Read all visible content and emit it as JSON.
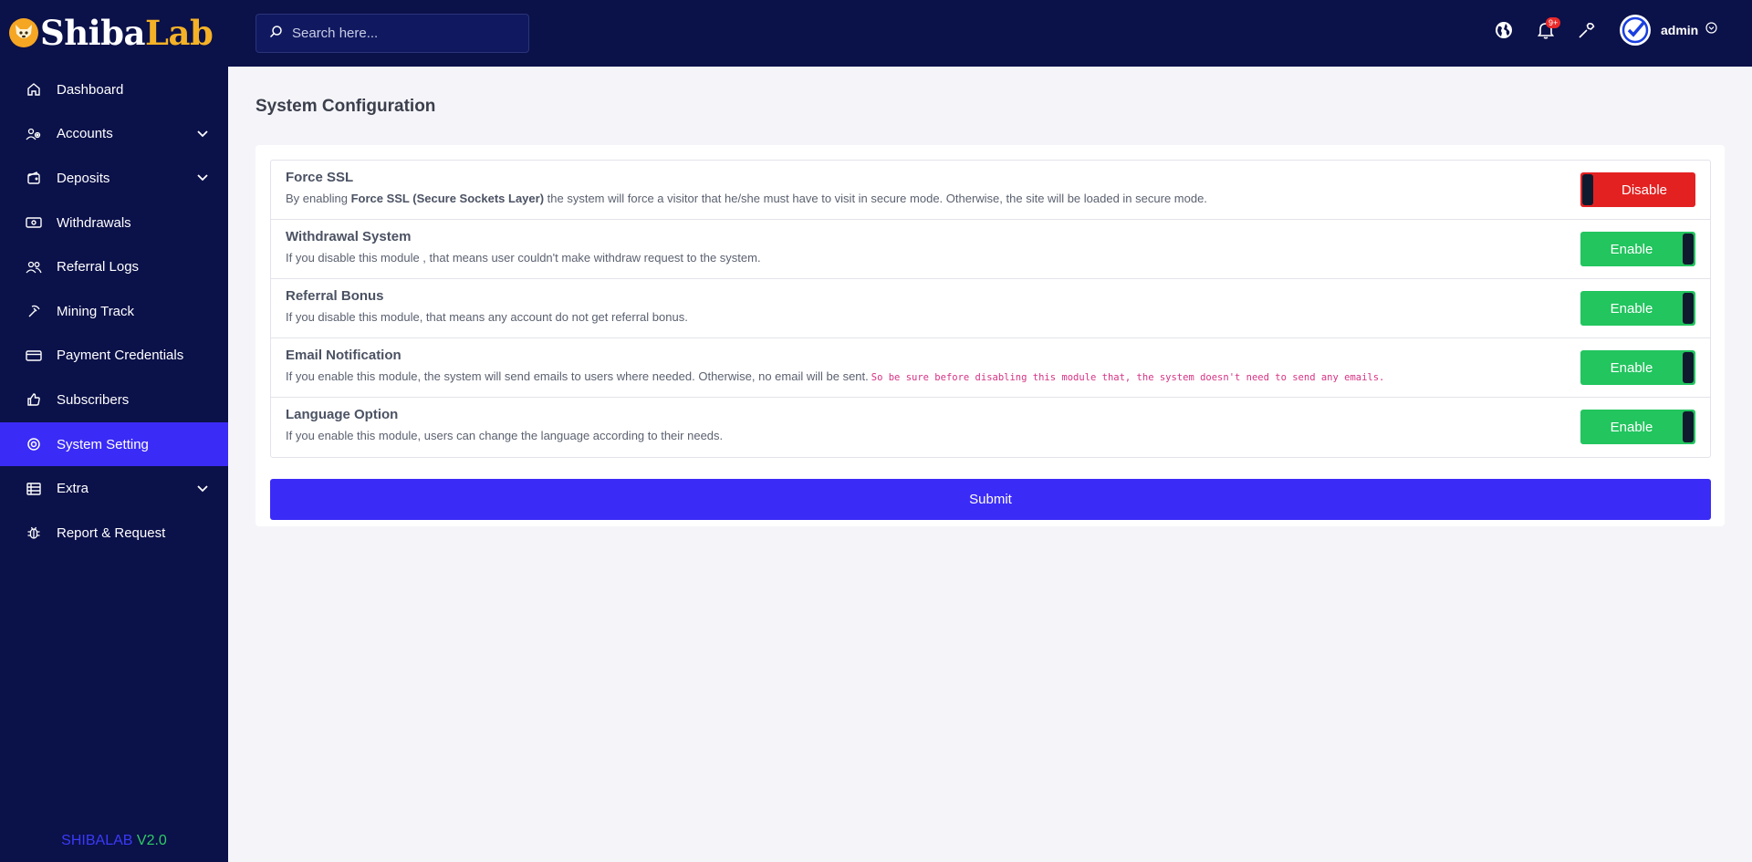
{
  "brand": {
    "part1": "Shiba",
    "part2": "Lab",
    "icon": "shiba-dog-icon"
  },
  "sidebar": {
    "items": [
      {
        "label": "Dashboard",
        "icon": "home-icon",
        "has_children": false
      },
      {
        "label": "Accounts",
        "icon": "users-gear-icon",
        "has_children": true
      },
      {
        "label": "Deposits",
        "icon": "wallet-icon",
        "has_children": true
      },
      {
        "label": "Withdrawals",
        "icon": "cash-icon",
        "has_children": false
      },
      {
        "label": "Referral Logs",
        "icon": "users-icon",
        "has_children": false
      },
      {
        "label": "Mining Track",
        "icon": "pickaxe-icon",
        "has_children": false
      },
      {
        "label": "Payment Credentials",
        "icon": "credit-card-icon",
        "has_children": false
      },
      {
        "label": "Subscribers",
        "icon": "thumbs-up-icon",
        "has_children": false
      },
      {
        "label": "System Setting",
        "icon": "settings-icon",
        "has_children": false,
        "active": true
      },
      {
        "label": "Extra",
        "icon": "list-icon",
        "has_children": true
      },
      {
        "label": "Report & Request",
        "icon": "bug-icon",
        "has_children": false
      }
    ],
    "version_name": "SHIBALAB",
    "version_num": "V2.0"
  },
  "header": {
    "search_placeholder": "Search here...",
    "notification_badge": "9+",
    "user_name": "admin"
  },
  "main": {
    "title": "System Configuration",
    "settings": [
      {
        "title": "Force SSL",
        "desc_pre": "By enabling ",
        "desc_bold": "Force SSL (Secure Sockets Layer)",
        "desc_post": " the system will force a visitor that he/she must have to visit in secure mode. Otherwise, the site will be loaded in secure mode.",
        "state_label": "Disable"
      },
      {
        "title": "Withdrawal System",
        "desc": "If you disable this module , that means user couldn't make withdraw request to the system.",
        "state_label": "Enable"
      },
      {
        "title": "Referral Bonus",
        "desc": "If you disable this module, that means any account do not get referral bonus.",
        "state_label": "Enable"
      },
      {
        "title": "Email Notification",
        "desc": "If you enable this module, the system will send emails to users where needed. Otherwise, no email will be sent.",
        "note": "So be sure before disabling this module that, the system doesn't need to send any emails.",
        "state_label": "Enable"
      },
      {
        "title": "Language Option",
        "desc": "If you enable this module, users can change the language according to their needs.",
        "state_label": "Enable"
      }
    ],
    "submit_label": "Submit"
  },
  "colors": {
    "sidebar_bg": "#0b1149",
    "active_item": "#3b2bf6",
    "enable": "#22c55e",
    "disable": "#e42121",
    "brand_yellow": "#f5b227"
  }
}
